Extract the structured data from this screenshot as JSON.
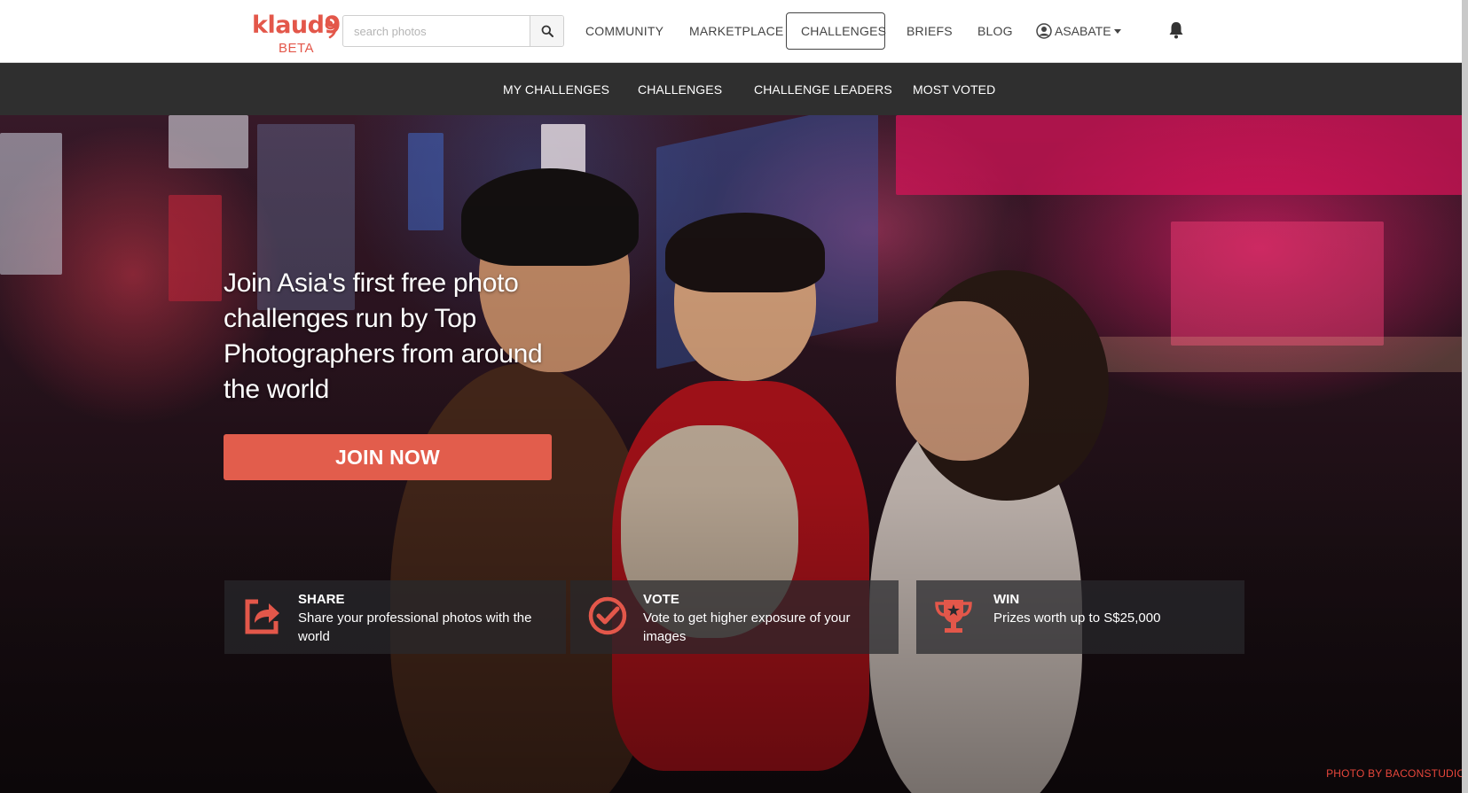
{
  "header": {
    "logo_text": "klaud9",
    "logo_badge": "BETA",
    "search": {
      "placeholder": "search photos",
      "value": ""
    },
    "nav": {
      "community": "COMMUNITY",
      "marketplace": "MARKETPLACE",
      "challenges": "CHALLENGES",
      "briefs": "BRIEFS",
      "blog": "BLOG"
    },
    "user_name": "ASABATE"
  },
  "subnav": {
    "my_challenges": "MY CHALLENGES",
    "challenges": "CHALLENGES",
    "challenge_leaders": "CHALLENGE LEADERS",
    "most_voted": "MOST VOTED"
  },
  "hero": {
    "headline": "Join Asia's first free photo challenges run by Top Photographers from around the world",
    "cta_label": "JOIN NOW",
    "features": {
      "share": {
        "title": "SHARE",
        "text": "Share your professional photos with the world",
        "icon": "share-icon"
      },
      "vote": {
        "title": "VOTE",
        "text": "Vote to get higher exposure of your images",
        "icon": "check-circle-icon"
      },
      "win": {
        "title": "WIN",
        "text": "Prizes worth up to S$25,000",
        "icon": "trophy-icon"
      }
    },
    "photo_credit": "PHOTO BY BACONSTUDIO"
  },
  "colors": {
    "brand": "#e3574a",
    "cta": "#e25d4c",
    "subnav_bg": "#2f2f2f",
    "credit": "#e6463b"
  }
}
